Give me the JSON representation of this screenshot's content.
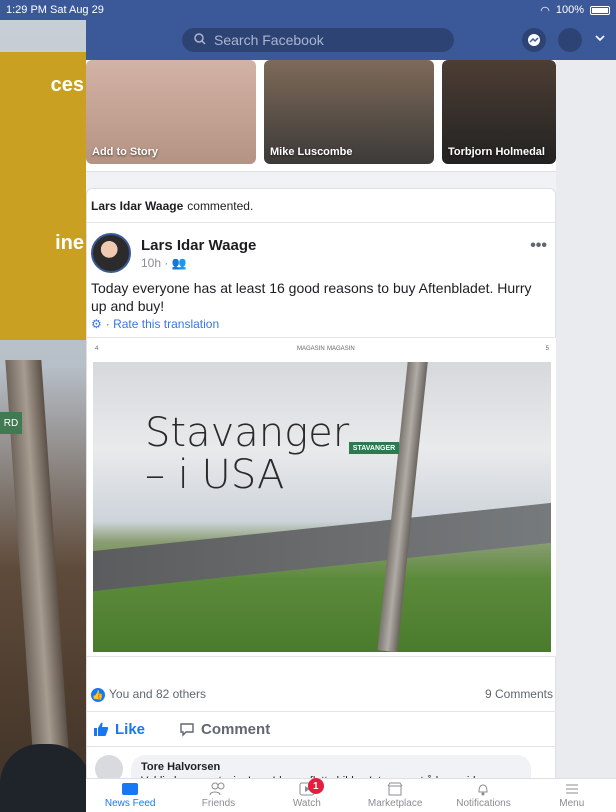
{
  "status_bar": {
    "time_date": "1:29 PM  Sat Aug 29",
    "battery": "100%"
  },
  "topbar": {
    "search_placeholder": "Search Facebook"
  },
  "overlay": {
    "line1": "ces",
    "line2": "ine"
  },
  "background": {
    "sign_text": "RD"
  },
  "stories": [
    {
      "label": "Add to Story"
    },
    {
      "label": "Mike Luscombe"
    },
    {
      "label": "Torbjorn Holmedal"
    }
  ],
  "post": {
    "activity_actor": "Lars Idar Waage",
    "activity_text": "commented.",
    "author": "Lars Idar Waage",
    "time": "10h · ",
    "text": "Today everyone has at least 16 good reasons to buy Aftenbladet. Hurry up and buy!",
    "rate_translation": " · Rate this translation",
    "magazine": {
      "header_left": "4",
      "header_center_left": "MAGASIN",
      "header_center_right": "MAGASIN",
      "header_right": "5",
      "title_line1": "Stavanger",
      "title_line2": "– i USA",
      "street_sign": "STAVANGER"
    },
    "reactions": "You and 82 others",
    "comments_count": "9 Comments",
    "like_label": "Like",
    "comment_label": "Comment",
    "comment": {
      "name": "Tore Halvorsen",
      "text": "Veldig bra reportasje, Lars Idar og flotte bilder. Interessant å høre videre om"
    }
  },
  "tabs": [
    {
      "label": "News Feed"
    },
    {
      "label": "Friends"
    },
    {
      "label": "Watch",
      "badge": "1"
    },
    {
      "label": "Marketplace"
    },
    {
      "label": "Notifications"
    },
    {
      "label": "Menu"
    }
  ],
  "colors": {
    "brand": "#3b5998",
    "accent": "#1877f2",
    "badge": "#e41e3f",
    "overlay": "#c9a021"
  }
}
